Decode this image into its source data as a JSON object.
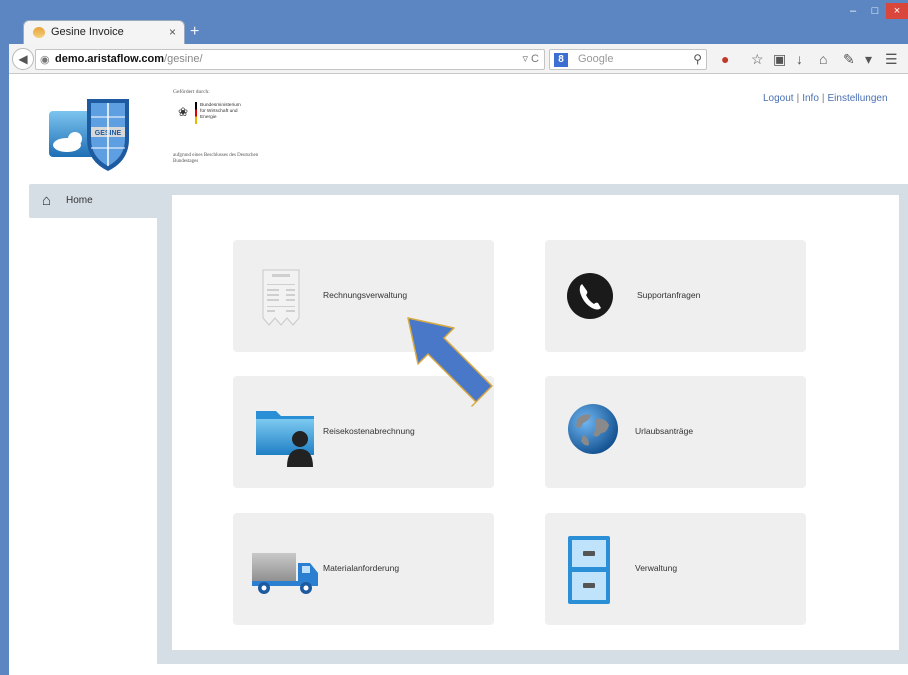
{
  "browser": {
    "tab_title": "Gesine Invoice",
    "tab_close": "×",
    "new_tab": "+",
    "url_host": "demo.aristaflow.com",
    "url_path": "/gesine/",
    "search_engine_badge": "8",
    "search_placeholder": "Google",
    "window_min": "–",
    "window_max": "□",
    "window_close": "×"
  },
  "sponsor": {
    "top_text": "Gefördert durch:",
    "ministry_lines": "Bundesministerium für Wirtschaft und Energie",
    "bottom_text": "aufgrund eines Beschlusses des Deutschen Bundestages"
  },
  "top_links": {
    "logout": "Logout",
    "separator": "|",
    "info": "Info",
    "settings": "Einstellungen"
  },
  "nav": {
    "home_label": "Home"
  },
  "tiles": [
    {
      "label": "Rechnungsverwaltung",
      "icon": "receipt-icon"
    },
    {
      "label": "Supportanfragen",
      "icon": "phone-icon"
    },
    {
      "label": "Reisekostenabrechnung",
      "icon": "folder-user-icon"
    },
    {
      "label": "Urlaubsanträge",
      "icon": "globe-icon"
    },
    {
      "label": "Materialanforderung",
      "icon": "truck-icon"
    },
    {
      "label": "Verwaltung",
      "icon": "cabinet-icon"
    }
  ],
  "colors": {
    "chrome_blue": "#5b86c2",
    "frame": "#d5dde5",
    "tile_bg": "#efefef",
    "arrow": "#4a78c9",
    "link": "#4a70b5"
  }
}
